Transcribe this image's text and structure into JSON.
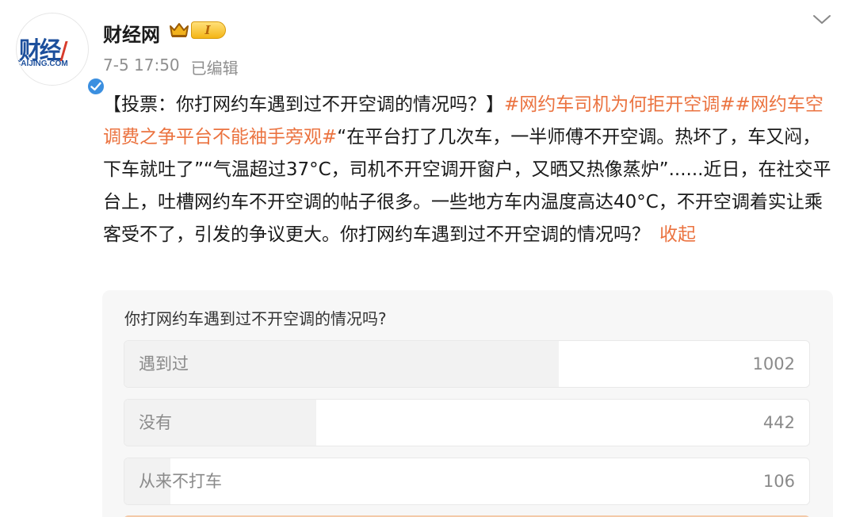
{
  "author": {
    "name": "财经网",
    "avatar_logo_main": "财经",
    "avatar_logo_sub": "CAIJING.COM",
    "level": "I",
    "verified": true,
    "crown_icon": "crown-icon",
    "verified_icon": "check-icon"
  },
  "meta": {
    "time": "7-5 17:50",
    "edited": "已编辑"
  },
  "post": {
    "text_1": "【投票：你打网约车遇到过不开空调的情况吗？】",
    "hashtag_1": "#网约车司机为何拒开空调#",
    "hashtag_2": "#网约车空调费之争平台不能袖手旁观#",
    "text_2": "“在平台打了几次车，一半师傅不开空调。热坏了，车又闷，下车就吐了”“气温超过37°C，司机不开空调开窗户，又晒又热像蒸炉”......近日，在社交平台上，吐槽网约车不开空调的帖子很多。一些地方车内温度高达40°C，不开空调着实让乘客受不了，引发的争议更大。你打网约车遇到过不开空调的情况吗？",
    "collapse_label": "收起"
  },
  "poll": {
    "question": "你打网约车遇到过不开空调的情况吗?",
    "options": [
      {
        "label": "遇到过",
        "count": "1002",
        "fill_fraction": 0.634
      },
      {
        "label": "没有",
        "count": "442",
        "fill_fraction": 0.28
      },
      {
        "label": "从来不打车",
        "count": "106",
        "fill_fraction": 0.067
      }
    ]
  },
  "colors": {
    "hashtag": "#eb7340",
    "verified": "#3b8fe0",
    "poll_bg": "#f7f7f7"
  }
}
